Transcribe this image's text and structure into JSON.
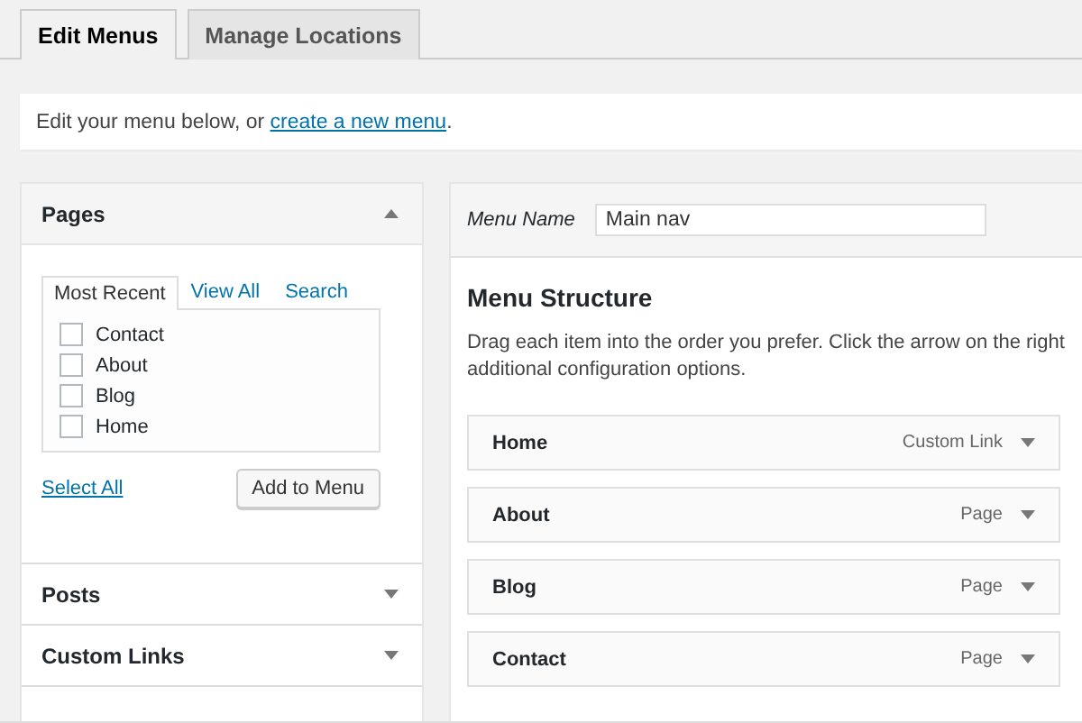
{
  "tabs": [
    {
      "label": "Edit Menus",
      "selected": true
    },
    {
      "label": "Manage Locations",
      "selected": false
    }
  ],
  "notice": {
    "text": "Edit your menu below, or ",
    "link": "create a new menu",
    "end": "."
  },
  "sections": [
    {
      "title": "Pages",
      "expanded": true,
      "tabs": [
        {
          "label": "Most Recent",
          "selected": true
        },
        {
          "label": "View All",
          "selected": false
        },
        {
          "label": "Search",
          "selected": false
        }
      ],
      "items": [
        {
          "label": "Contact",
          "checked": false
        },
        {
          "label": "About",
          "checked": false
        },
        {
          "label": "Blog",
          "checked": false
        },
        {
          "label": "Home",
          "checked": false
        }
      ],
      "select_all": "Select All",
      "add_button": "Add to Menu"
    },
    {
      "title": "Posts",
      "expanded": false
    },
    {
      "title": "Custom Links",
      "expanded": false
    }
  ],
  "menu_name": {
    "label": "Menu Name",
    "value": "Main nav"
  },
  "structure": {
    "title": "Menu Structure",
    "description": [
      "Drag each item into the order you prefer. Click the arrow on the right",
      "additional configuration options."
    ],
    "items": [
      {
        "title": "Home",
        "type": "Custom Link"
      },
      {
        "title": "About",
        "type": "Page"
      },
      {
        "title": "Blog",
        "type": "Page"
      },
      {
        "title": "Contact",
        "type": "Page"
      }
    ]
  }
}
